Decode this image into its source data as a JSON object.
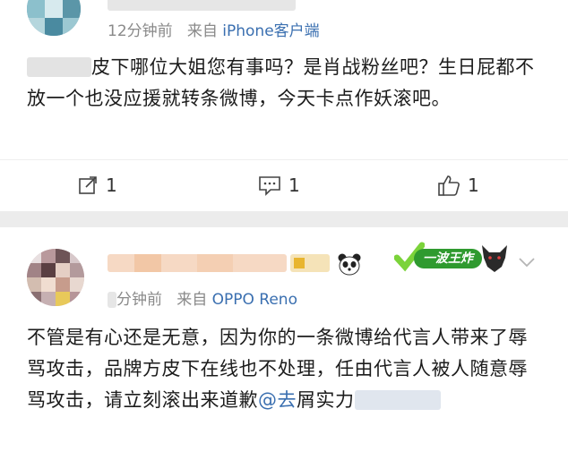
{
  "post1": {
    "time": "12分钟前",
    "via_prefix": "来自",
    "source": "iPhone客户端",
    "text": "皮下哪位大姐您有事吗？是肖战粉丝吧？生日屁都不放一个也没应援就转条微博，今天卡点作妖滚吧。",
    "actions": {
      "repost_count": "1",
      "comment_count": "1",
      "like_count": "1"
    }
  },
  "post2": {
    "time": "分钟前",
    "via_prefix": "来自",
    "source": "OPPO Reno",
    "text": "不管是有心还是无意，因为你的一条微博给代言人带来了辱骂攻击，品牌方皮下在线也不处理，任由代言人被人随意辱骂攻击，请立刻滚出来道歉",
    "mention": "@去",
    "text_tail": "屑实力",
    "badge_label": "一波王炸",
    "badge_color": "#2f9a2f",
    "panda_icon": "panda-icon",
    "wolf_icon": "wolf-icon"
  },
  "colors": {
    "link": "#3a6fb0",
    "meta": "#8a8a8a",
    "divider": "#ececec"
  }
}
